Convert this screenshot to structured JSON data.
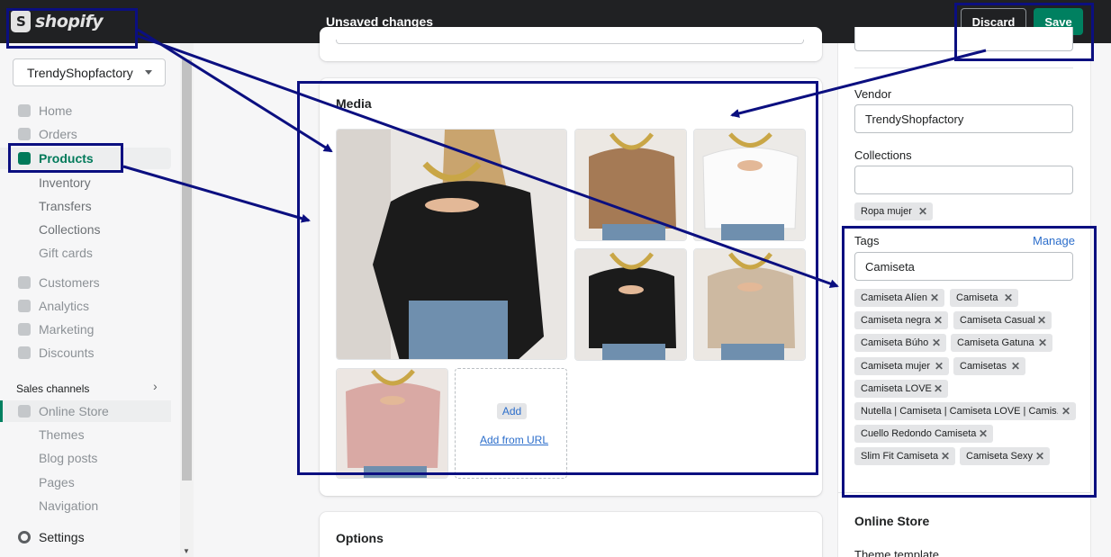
{
  "topbar": {
    "logo_text": "shopify",
    "status": "Unsaved changes",
    "discard_label": "Discard",
    "save_label": "Save"
  },
  "sidebar": {
    "store_name": "TrendyShopfactory",
    "items": [
      {
        "label": "Home"
      },
      {
        "label": "Orders"
      },
      {
        "label": "Products"
      },
      {
        "label": "Inventory"
      },
      {
        "label": "Transfers"
      },
      {
        "label": "Collections"
      },
      {
        "label": "Gift cards"
      },
      {
        "label": "Customers"
      },
      {
        "label": "Analytics"
      },
      {
        "label": "Marketing"
      },
      {
        "label": "Discounts"
      }
    ],
    "sales_channels_label": "Sales channels",
    "channels": [
      {
        "label": "Online Store"
      },
      {
        "label": "Themes"
      },
      {
        "label": "Blog posts"
      },
      {
        "label": "Pages"
      },
      {
        "label": "Navigation"
      }
    ],
    "settings_label": "Settings"
  },
  "media": {
    "title": "Media",
    "add_label": "Add",
    "add_url_label": "Add from URL"
  },
  "options": {
    "title": "Options"
  },
  "organization": {
    "vendor_label": "Vendor",
    "vendor_value": "TrendyShopfactory",
    "collections_label": "Collections",
    "collections_value": "",
    "collection_tags": [
      "Ropa mujer"
    ],
    "tags_label": "Tags",
    "manage_label": "Manage",
    "tags_input_value": "Camiseta",
    "tags": [
      "Camiseta Alíen",
      "Camiseta",
      "Camiseta negra",
      "Camiseta Casual",
      "Camiseta Búho",
      "Camiseta Gatuna",
      "Camiseta mujer",
      "Camisetas",
      "Camiseta LOVE",
      "Nutella | Camiseta | Camiseta LOVE | Camis...",
      "Cuello Redondo Camiseta",
      "Slim Fit Camiseta",
      "Camiseta Sexy"
    ]
  },
  "online_store": {
    "title": "Online Store",
    "theme_template_label": "Theme template"
  },
  "colors": {
    "topbar": "#202123",
    "save_green": "#008060",
    "active_green": "#007a5a",
    "link_blue": "#2c6ecb",
    "annotation_navy": "#0b0f80"
  }
}
